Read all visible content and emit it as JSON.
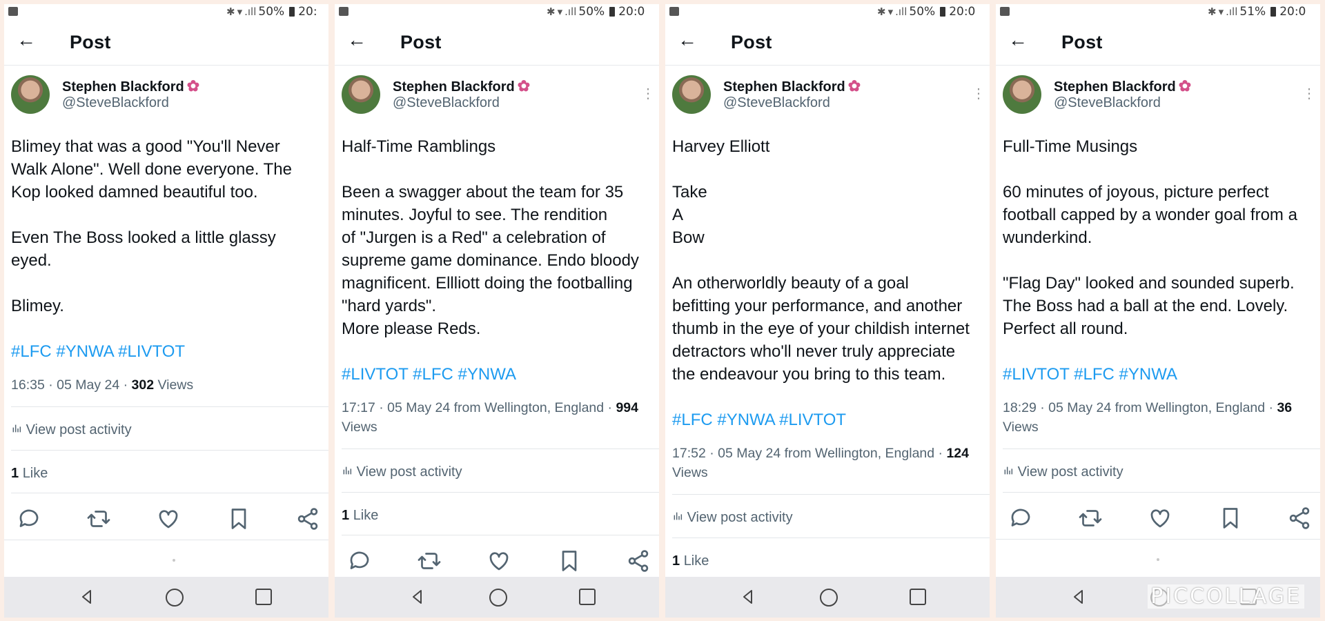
{
  "header_title": "Post",
  "author": {
    "name": "Stephen Blackford",
    "handle": "@SteveBlackford"
  },
  "actions": {
    "view_activity": "View post activity",
    "like_word": "Like"
  },
  "icons": [
    "back-arrow-icon",
    "reply-icon",
    "retweet-icon",
    "heart-icon",
    "bookmark-icon",
    "share-icon",
    "more-icon",
    "chart-icon",
    "flower-icon"
  ],
  "colors": {
    "link": "#1d9bf0",
    "text": "#0f1419",
    "muted": "#536471",
    "flower": "#d4508a"
  },
  "watermark": "PICCOLLAGE",
  "panels": [
    {
      "status": {
        "battery": "50%",
        "time": "20:"
      },
      "text": "Blimey that was a good \"You'll Never\nWalk Alone\". Well done everyone. The\nKop looked damned beautiful too.\n\nEven The Boss looked a little glassy\neyed.\n\nBlimey.",
      "hashtags": "#LFC #YNWA #LIVTOT",
      "meta_prefix": "16:35 · 05 May 24 · ",
      "views_count": "302",
      "views_suffix": " Views",
      "likes_count": "1"
    },
    {
      "status": {
        "battery": "50%",
        "time": "20:0"
      },
      "text": "Half-Time Ramblings\n\nBeen a swagger about the team for 35\nminutes. Joyful to see. The rendition\nof \"Jurgen is a Red\" a celebration of\nsupreme game dominance. Endo bloody\nmagnificent. Ellliott doing the footballing\n\"hard yards\".\nMore please Reds.",
      "hashtags": "#LIVTOT #LFC #YNWA",
      "meta_prefix": "17:17 · 05 May 24 from Wellington, England · ",
      "views_count": "994",
      "views_suffix": "Views",
      "likes_count": "1"
    },
    {
      "status": {
        "battery": "50%",
        "time": "20:0"
      },
      "text": "Harvey Elliott\n\nTake\nA\nBow\n\nAn otherworldly beauty of a goal\nbefitting your performance, and another\nthumb in the eye of your childish internet\ndetractors who'll never truly appreciate\nthe endeavour you bring to this team.",
      "hashtags": "#LFC #YNWA #LIVTOT",
      "meta_prefix": "17:52 · 05 May 24 from Wellington, England · ",
      "views_count": "124",
      "views_suffix": "Views",
      "likes_count": "1"
    },
    {
      "status": {
        "battery": "51%",
        "time": "20:0"
      },
      "text": "Full-Time Musings\n\n60 minutes of joyous, picture perfect\nfootball capped by a wonder goal from a\nwunderkind.\n\n\"Flag Day\" looked and sounded superb.\nThe Boss had a ball at the end. Lovely.\nPerfect all round.",
      "hashtags": "#LIVTOT #LFC #YNWA",
      "meta_prefix": "18:29 · 05 May 24 from Wellington, England · ",
      "views_count": "36",
      "views_suffix": "Views"
    }
  ]
}
